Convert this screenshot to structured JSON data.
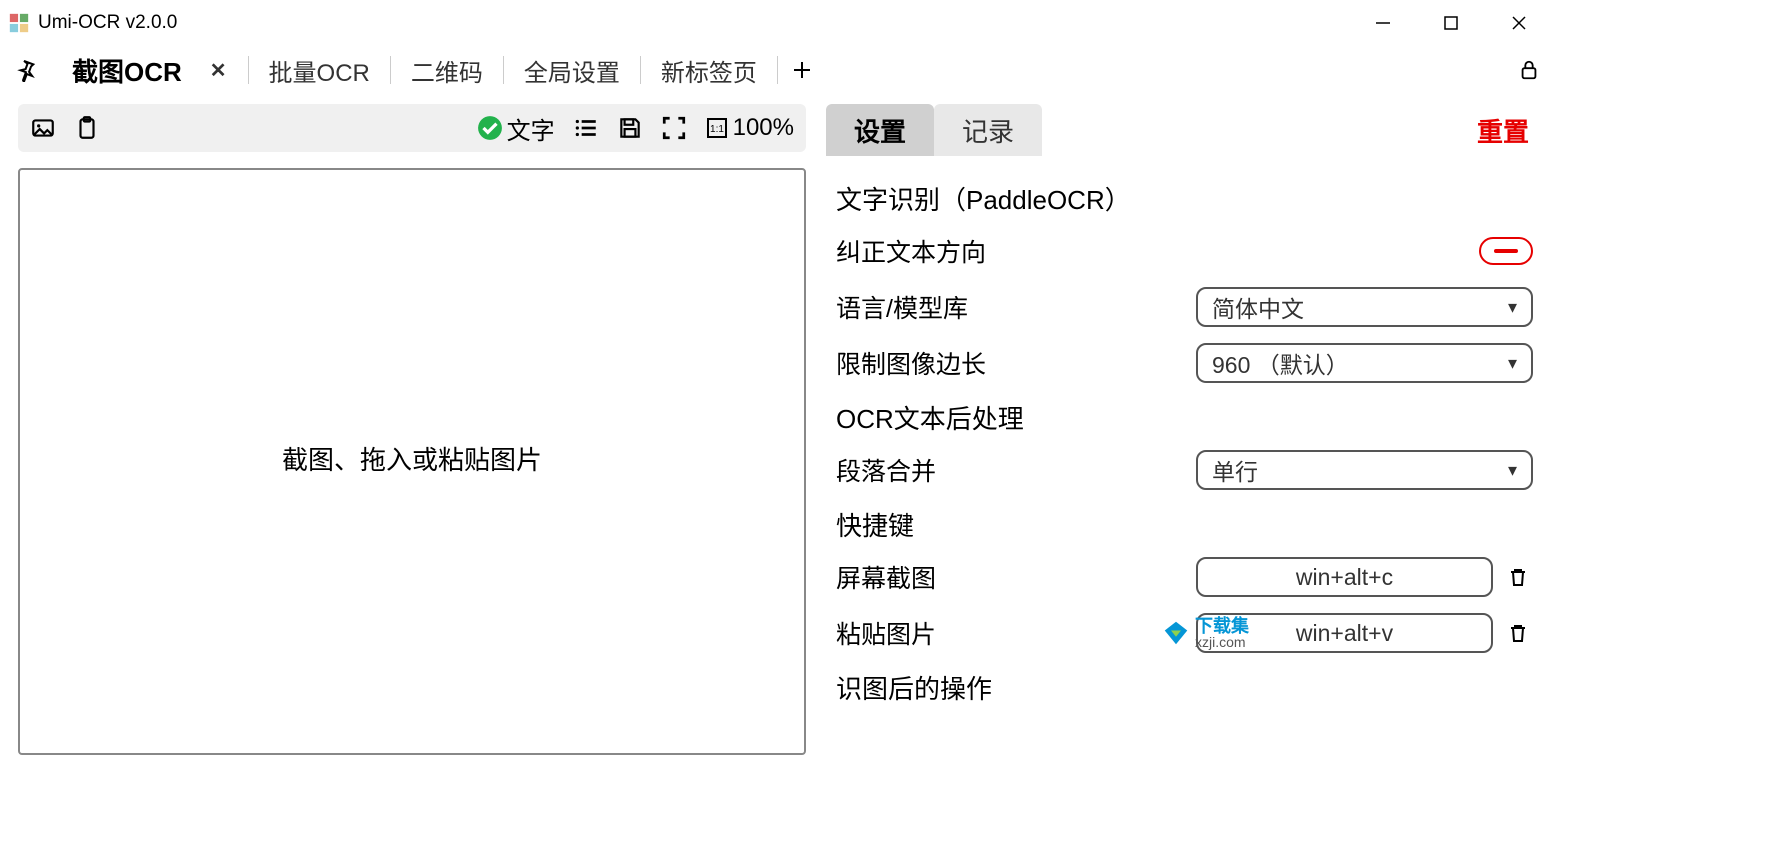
{
  "window": {
    "title": "Umi-OCR v2.0.0"
  },
  "tabs": [
    {
      "label": "截图OCR",
      "active": true,
      "closable": true
    },
    {
      "label": "批量OCR"
    },
    {
      "label": "二维码"
    },
    {
      "label": "全局设置"
    },
    {
      "label": "新标签页"
    }
  ],
  "left": {
    "mode_label": "文字",
    "zoom": "100%",
    "canvas_hint": "截图、拖入或粘贴图片"
  },
  "right": {
    "tabs": {
      "settings": "设置",
      "log": "记录",
      "reset": "重置"
    },
    "sections": {
      "ocr_engine_title": "文字识别（PaddleOCR）",
      "direction_label": "纠正文本方向",
      "language_label": "语言/模型库",
      "language_value": "简体中文",
      "limit_label": "限制图像边长",
      "limit_value": "960 （默认）",
      "post_title": "OCR文本后处理",
      "para_label": "段落合并",
      "para_value": "单行",
      "hotkey_title": "快捷键",
      "shot_label": "屏幕截图",
      "shot_key": "win+alt+c",
      "paste_label": "粘贴图片",
      "paste_key": "win+alt+v",
      "after_title": "识图后的操作"
    }
  },
  "watermark": {
    "line1": "下载集",
    "line2": "xzji.com"
  }
}
